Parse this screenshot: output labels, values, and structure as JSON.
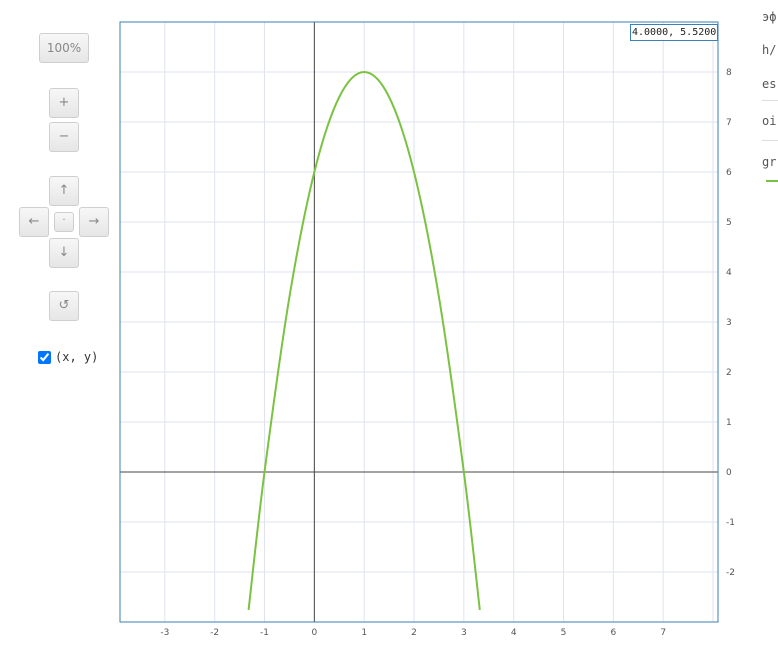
{
  "toolbar": {
    "zoom_reset_label": "100%",
    "zoom_in_label": "+",
    "zoom_out_label": "−",
    "pan_up_label": "↑",
    "pan_left_label": "←",
    "pan_center_label": "·",
    "pan_right_label": "→",
    "pan_down_label": "↓",
    "reset_label": "↺",
    "show_coords_label": "(x, y)",
    "show_coords_checked": true
  },
  "coord_readout": "4.0000, 5.5200",
  "side_panel": {
    "fragments": [
      "эф",
      "h/",
      "es",
      "oi",
      "gr"
    ],
    "series_color": "#7cc242"
  },
  "chart_data": {
    "type": "line",
    "xlim": [
      -3.9,
      8.1
    ],
    "ylim": [
      -3.0,
      9.0
    ],
    "x_ticks": [
      -3,
      -2,
      -1,
      0,
      1,
      2,
      3,
      4,
      5,
      6,
      7
    ],
    "y_ticks": [
      -2,
      -1,
      0,
      1,
      2,
      3,
      4,
      5,
      6,
      7,
      8
    ],
    "grid": true,
    "title": "",
    "xlabel": "",
    "ylabel": "",
    "series": [
      {
        "color": "#7cc242",
        "x": [
          -1.32,
          -1,
          -0.5,
          0,
          0.5,
          1,
          1.5,
          2,
          2.5,
          3,
          3.32
        ],
        "y": [
          -2.76,
          0,
          3.5,
          6,
          7.5,
          8,
          7.5,
          6,
          3.5,
          0,
          -2.76
        ]
      }
    ]
  }
}
